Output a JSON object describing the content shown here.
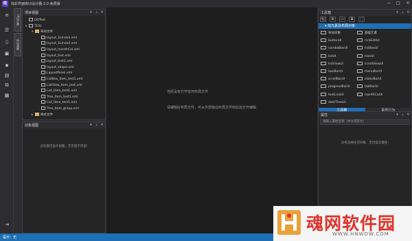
{
  "window": {
    "app_icon_text": "炫",
    "title": "炫彩界面库UI设计器-2.0-免费版",
    "controls": [
      "—",
      "□",
      "✕"
    ]
  },
  "left_toolbar": {
    "icons": [
      "menu-icon",
      "list-icon",
      "new-file-icon",
      "open-file-icon",
      "save-icon",
      "save-all-icon",
      "export-icon",
      "import-icon"
    ],
    "bottom_icon": "collapse-icon"
  },
  "vertical_tabs": [
    "UI设计器",
    "项目视图"
  ],
  "project_panel": {
    "title": "项目视图",
    "tree": [
      {
        "label": "QQTest",
        "level": 0,
        "type": "file",
        "expanded": null
      },
      {
        "label": "TESt",
        "level": 0,
        "type": "file",
        "expanded": true
      },
      {
        "label": "布局文件",
        "level": 1,
        "type": "folder",
        "expanded": true
      },
      {
        "label": "layout_1kindo1.xml",
        "level": 2,
        "type": "file",
        "expanded": null
      },
      {
        "label": "layout_1kindo2.xml",
        "level": 2,
        "type": "file",
        "expanded": null
      },
      {
        "label": "layout_monthCal.xml",
        "level": 2,
        "type": "file",
        "expanded": null
      },
      {
        "label": "layout_test.xml",
        "level": 2,
        "type": "file",
        "expanded": null
      },
      {
        "label": "layout_test1.xml",
        "level": 2,
        "type": "file",
        "expanded": null
      },
      {
        "label": "layout_shape.xml",
        "level": 2,
        "type": "file",
        "expanded": null
      },
      {
        "label": "LayoutPanel.xml",
        "level": 2,
        "type": "file",
        "expanded": null
      },
      {
        "label": "ListBox_Item_test1.xml",
        "level": 2,
        "type": "file",
        "expanded": null
      },
      {
        "label": "ListView_Item_test.xml",
        "level": 2,
        "type": "file",
        "expanded": null
      },
      {
        "label": "List_Item_test1.xml",
        "level": 2,
        "type": "file",
        "expanded": null
      },
      {
        "label": "Tree_Item_test1.xml",
        "level": 2,
        "type": "file",
        "expanded": null
      },
      {
        "label": "List_Item_test1.xml",
        "level": 2,
        "type": "file",
        "expanded": null
      },
      {
        "label": "Tree_Item_group.xml",
        "level": 2,
        "type": "file",
        "expanded": null
      },
      {
        "label": "样式文件",
        "level": 1,
        "type": "folder",
        "expanded": false
      }
    ]
  },
  "object_panel": {
    "title": "对象视图",
    "empty_text": "没有激活设计视图，无可提示内容!"
  },
  "center": {
    "line1": "当前没有打开任何布局文件",
    "line2": "请编辑好布局文件，可从外部拖动布局文件到此处打开编辑"
  },
  "toolbox_panel": {
    "title": "工具箱",
    "tools": [
      "↖",
      "⊞",
      "▭",
      "⧉",
      "⬚"
    ],
    "group_label": "炫元素及布局对象",
    "items_left": [
      "布局对象",
      "buttonUI",
      "comboBoxUI",
      "listUI",
      "listViewUI",
      "toolBarUI",
      "scrollBarUI",
      "progressBarUI",
      "textLinkUI",
      "dateTimeUI"
    ],
    "items_right": [
      "基础元素",
      "richEditUI",
      "listBoxUI",
      "treeUI",
      "scrollViewUI",
      "menuBarUI",
      "sliderBarUI",
      "tabBarUI",
      "monthCalUI"
    ],
    "tabs": [
      {
        "label": "工具箱",
        "active": true
      },
      {
        "label": "事件行为",
        "active": false
      }
    ]
  },
  "property_panel": {
    "title": "属性",
    "search_placeholder": "请输入属性名称（中文或英文）",
    "empty_text": "没有选择任何对象，无可提示属性!"
  },
  "statusbar": {
    "text": "提示：无"
  },
  "watermark": {
    "cn": "魂网软件园",
    "en": "WWW.HNWDW.COM"
  },
  "colors": {
    "accent": "#1f6fb4",
    "bg": "#2d2d30",
    "panel": "#252526",
    "editor": "#1e1e1e",
    "watermark_red": "#e0332a"
  }
}
